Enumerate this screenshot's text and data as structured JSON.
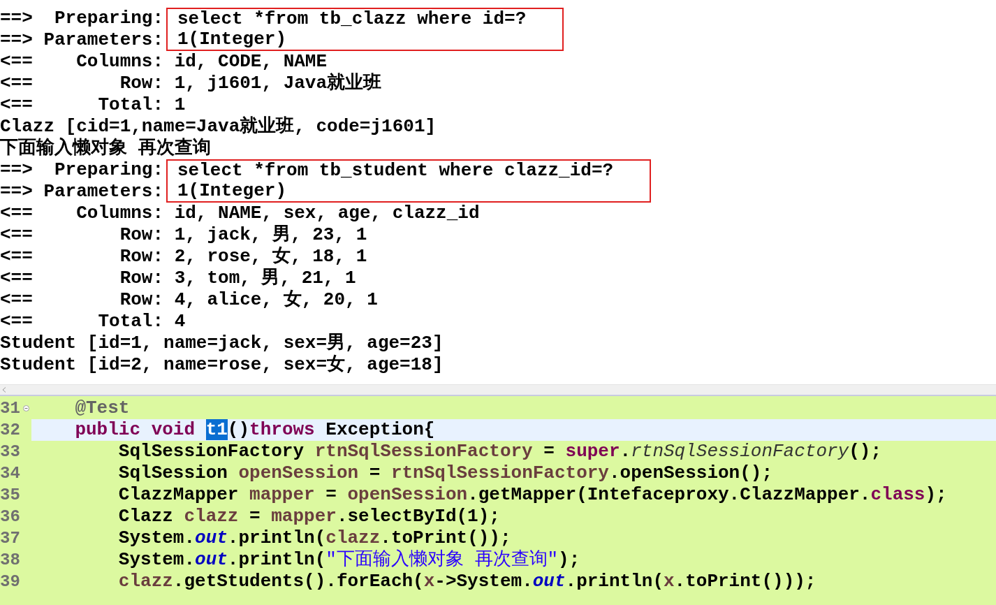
{
  "console": {
    "entries": [
      {
        "kind": "query",
        "rows": [
          {
            "label": "==>  Preparing:",
            "value": "select *from tb_clazz where id=?"
          },
          {
            "label": "==> Parameters:",
            "value": "1(Integer)"
          }
        ]
      },
      {
        "kind": "line",
        "text": "<==    Columns: id, CODE, NAME"
      },
      {
        "kind": "line",
        "text": "<==        Row: 1, j1601, Java就业班"
      },
      {
        "kind": "line",
        "text": "<==      Total: 1"
      },
      {
        "kind": "line",
        "text": "Clazz [cid=1,name=Java就业班, code=j1601]"
      },
      {
        "kind": "line",
        "text": "下面输入懒对象 再次查询"
      },
      {
        "kind": "query",
        "rows": [
          {
            "label": "==>  Preparing:",
            "value": "select *from tb_student where clazz_id=?"
          },
          {
            "label": "==> Parameters:",
            "value": "1(Integer)"
          }
        ]
      },
      {
        "kind": "line",
        "text": "<==    Columns: id, NAME, sex, age, clazz_id"
      },
      {
        "kind": "line",
        "text": "<==        Row: 1, jack, 男, 23, 1"
      },
      {
        "kind": "line",
        "text": "<==        Row: 2, rose, 女, 18, 1"
      },
      {
        "kind": "line",
        "text": "<==        Row: 3, tom, 男, 21, 1"
      },
      {
        "kind": "line",
        "text": "<==        Row: 4, alice, 女, 20, 1"
      },
      {
        "kind": "line",
        "text": "<==      Total: 4"
      },
      {
        "kind": "line",
        "text": "Student [id=1, name=jack, sex=男, age=23]"
      },
      {
        "kind": "line",
        "text": "Student [id=2, name=rose, sex=女, age=18]"
      }
    ]
  },
  "editor": {
    "lines": [
      {
        "number": "31",
        "fold_marker": true,
        "current": false,
        "tokens": [
          {
            "kind": "annotation",
            "text": "    @Test"
          }
        ]
      },
      {
        "number": "32",
        "fold_marker": false,
        "current": true,
        "tokens": [
          {
            "kind": "keyword",
            "text": "    public void "
          },
          {
            "kind": "selected",
            "text": "t1"
          },
          {
            "kind": "plain",
            "text": "()"
          },
          {
            "kind": "keyword",
            "text": "throws"
          },
          {
            "kind": "plain",
            "text": " Exception{"
          }
        ]
      },
      {
        "number": "33",
        "fold_marker": false,
        "current": false,
        "tokens": [
          {
            "kind": "plain",
            "text": "        SqlSessionFactory "
          },
          {
            "kind": "local",
            "text": "rtnSqlSessionFactory"
          },
          {
            "kind": "plain",
            "text": " = "
          },
          {
            "kind": "keyword",
            "text": "super"
          },
          {
            "kind": "plain",
            "text": "."
          },
          {
            "kind": "static",
            "text": "rtnSqlSessionFactory"
          },
          {
            "kind": "plain",
            "text": "();"
          }
        ]
      },
      {
        "number": "34",
        "fold_marker": false,
        "current": false,
        "tokens": [
          {
            "kind": "plain",
            "text": "        SqlSession "
          },
          {
            "kind": "local",
            "text": "openSession"
          },
          {
            "kind": "plain",
            "text": " = "
          },
          {
            "kind": "local",
            "text": "rtnSqlSessionFactory"
          },
          {
            "kind": "plain",
            "text": ".openSession();"
          }
        ]
      },
      {
        "number": "35",
        "fold_marker": false,
        "current": false,
        "tokens": [
          {
            "kind": "plain",
            "text": "        ClazzMapper "
          },
          {
            "kind": "local",
            "text": "mapper"
          },
          {
            "kind": "plain",
            "text": " = "
          },
          {
            "kind": "local",
            "text": "openSession"
          },
          {
            "kind": "plain",
            "text": ".getMapper(Intefaceproxy.ClazzMapper."
          },
          {
            "kind": "keyword",
            "text": "class"
          },
          {
            "kind": "plain",
            "text": ");"
          }
        ]
      },
      {
        "number": "36",
        "fold_marker": false,
        "current": false,
        "tokens": [
          {
            "kind": "plain",
            "text": "        Clazz "
          },
          {
            "kind": "local",
            "text": "clazz"
          },
          {
            "kind": "plain",
            "text": " = "
          },
          {
            "kind": "local",
            "text": "mapper"
          },
          {
            "kind": "plain",
            "text": ".selectById(1);"
          }
        ]
      },
      {
        "number": "37",
        "fold_marker": false,
        "current": false,
        "tokens": [
          {
            "kind": "plain",
            "text": "        System."
          },
          {
            "kind": "field",
            "text": "out"
          },
          {
            "kind": "plain",
            "text": ".println("
          },
          {
            "kind": "local",
            "text": "clazz"
          },
          {
            "kind": "plain",
            "text": ".toPrint());"
          }
        ]
      },
      {
        "number": "38",
        "fold_marker": false,
        "current": false,
        "tokens": [
          {
            "kind": "plain",
            "text": "        System."
          },
          {
            "kind": "field",
            "text": "out"
          },
          {
            "kind": "plain",
            "text": ".println("
          },
          {
            "kind": "string",
            "text": "\"下面输入懒对象 再次查询\""
          },
          {
            "kind": "plain",
            "text": ");"
          }
        ]
      },
      {
        "number": "39",
        "fold_marker": false,
        "current": false,
        "tokens": [
          {
            "kind": "local",
            "text": "        clazz"
          },
          {
            "kind": "plain",
            "text": ".getStudents().forEach("
          },
          {
            "kind": "local",
            "text": "x"
          },
          {
            "kind": "plain",
            "text": "->System."
          },
          {
            "kind": "field",
            "text": "out"
          },
          {
            "kind": "plain",
            "text": ".println("
          },
          {
            "kind": "local",
            "text": "x"
          },
          {
            "kind": "plain",
            "text": ".toPrint()));"
          }
        ]
      }
    ]
  }
}
